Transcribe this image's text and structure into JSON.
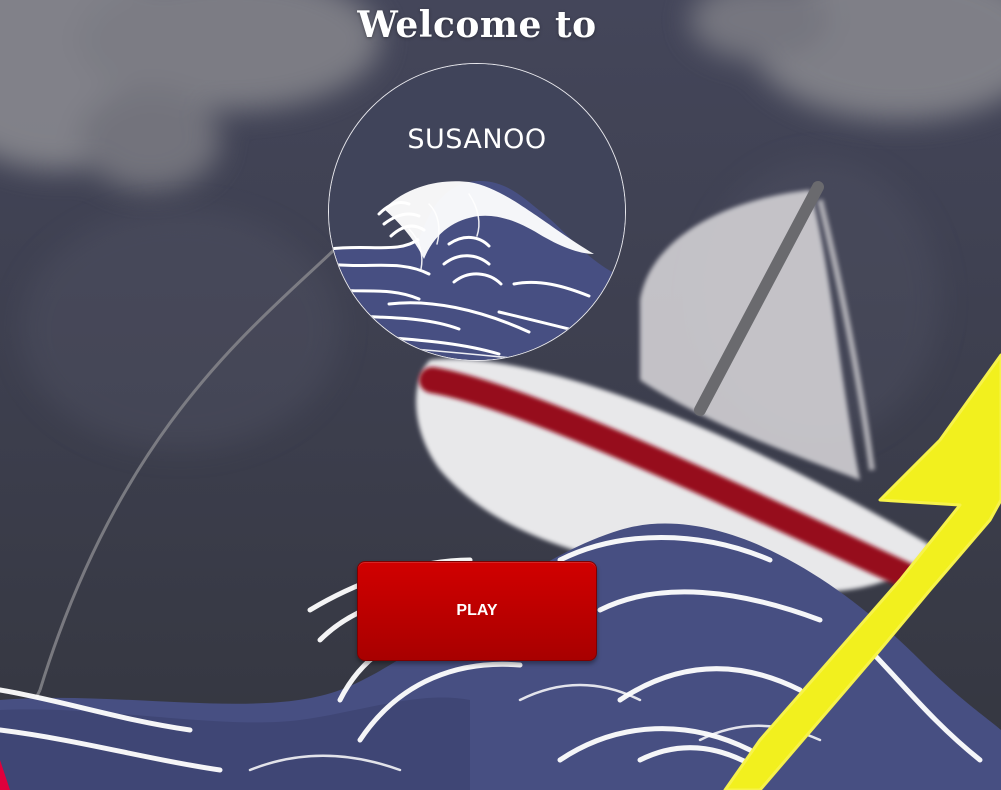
{
  "screen": {
    "welcome_text": "Welcome to",
    "logo": {
      "title": "SUSANOO",
      "icon": "great-wave-icon"
    },
    "play_button_label": "PLAY"
  },
  "colors": {
    "storm_sky": "#3e404e",
    "cloud": "#86868c",
    "sea": "#474f82",
    "foam": "#ffffff",
    "hull_stripe": "#96101c",
    "sail": "#d0cfd2",
    "lightning": "#f2f01e",
    "play_button": "#c00000"
  }
}
